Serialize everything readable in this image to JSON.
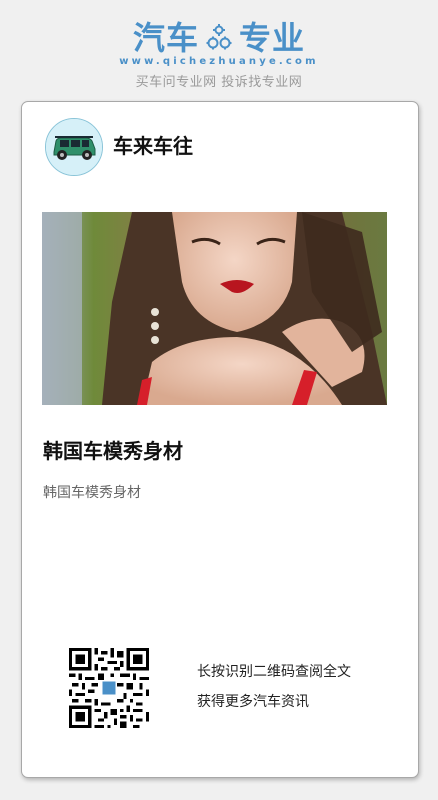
{
  "header": {
    "logo_left": "汽车",
    "logo_right": "专业",
    "logo_url": "www.qichezhuanye.com",
    "tagline": "买车问专业网 投诉找专业网",
    "brand_color": "#4a90c8"
  },
  "card": {
    "account_name": "车来车往",
    "avatar_icon": "green-car-avatar",
    "photo_icon": "woman-red-dress-photo",
    "article_title": "韩国车模秀身材",
    "article_summary": "韩国车模秀身材",
    "qr_line1": "长按识别二维码查阅全文",
    "qr_line2": "获得更多汽车资讯"
  }
}
